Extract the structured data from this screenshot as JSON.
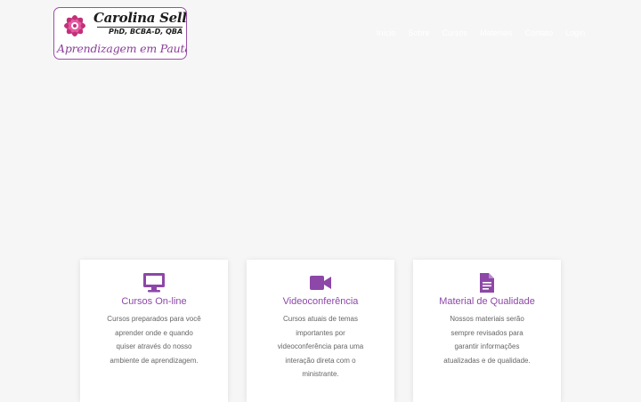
{
  "brand": {
    "name": "Carolina Sella",
    "credentials": "PhD, BCBA-D, QBA",
    "tagline": "Aprendizagem em Pauta"
  },
  "nav": {
    "items": [
      {
        "label": "Início"
      },
      {
        "label": "Sobre"
      },
      {
        "label": "Cursos"
      },
      {
        "label": "Materiais"
      },
      {
        "label": "Contato"
      },
      {
        "label": "Login"
      }
    ]
  },
  "features": [
    {
      "icon": "monitor-icon",
      "title": "Cursos On-line",
      "description": "Cursos preparados para você aprender onde e quando quiser através do nosso ambiente de aprendizagem."
    },
    {
      "icon": "video-camera-icon",
      "title": "Videoconferência",
      "description": "Cursos atuais de temas importantes por videoconferência para uma interação direta com o ministrante."
    },
    {
      "icon": "document-icon",
      "title": "Material de Qualidade",
      "description": "Nossos materiais serão sempre revisados para garantir informações atualizadas e de qualidade."
    }
  ],
  "colors": {
    "accent": "#8d47a8",
    "background": "#f6f6f6",
    "card": "#ffffff",
    "text": "#666666"
  }
}
